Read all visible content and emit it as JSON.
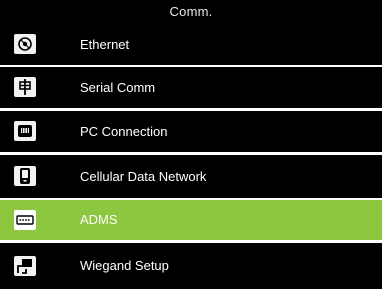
{
  "header": {
    "title": "Comm."
  },
  "menu": {
    "items": [
      {
        "label": "Ethernet",
        "icon": "ethernet-icon",
        "selected": false
      },
      {
        "label": "Serial Comm",
        "icon": "serial-comm-icon",
        "selected": false
      },
      {
        "label": "PC Connection",
        "icon": "pc-connection-icon",
        "selected": false
      },
      {
        "label": "Cellular Data Network",
        "icon": "cellular-data-icon",
        "selected": false
      },
      {
        "label": "ADMS",
        "icon": "adms-icon",
        "selected": true
      },
      {
        "label": "Wiegand Setup",
        "icon": "wiegand-setup-icon",
        "selected": false
      }
    ]
  },
  "colors": {
    "background": "#000000",
    "selected_row": "#8dc63f",
    "separator": "#ffffff",
    "text": "#ffffff",
    "icon_tile": "#f2f2f2"
  }
}
